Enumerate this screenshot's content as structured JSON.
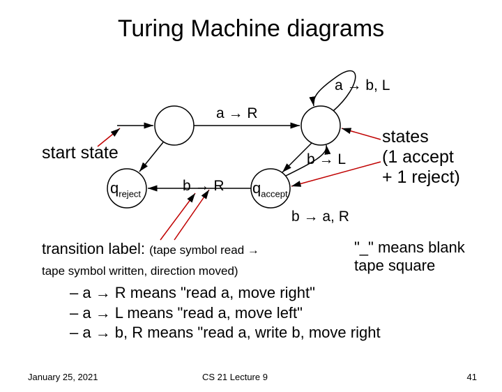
{
  "title": "Turing Machine diagrams",
  "labels": {
    "start_state": "start state",
    "a_to_R": "a → R",
    "b_to_R": "b → R",
    "a_to_bL": "a → b, L",
    "b_to_L": "b → L",
    "b_to_aR": "b → a, R",
    "q_reject_main": "q",
    "q_reject_sub": "reject",
    "q_accept_main": "q",
    "q_accept_sub": "accept"
  },
  "states_note": {
    "line1": "states",
    "line2": "(1 accept",
    "line3": "+ 1 reject)"
  },
  "transition_text": {
    "lead": "transition label: ",
    "paren1": "(tape symbol read → ",
    "paren2": "tape symbol written, direction moved)"
  },
  "blank_note": {
    "line1": "\"_\" means blank",
    "line2": "tape square"
  },
  "bullets": {
    "b1": "– a → R means \"read a, move right\"",
    "b2": "– a → L means \"read a, move left\"",
    "b3": "– a → b, R means \"read a, write b, move right"
  },
  "footer": {
    "date": "January 25, 2021",
    "mid": "CS 21 Lecture 9",
    "page": "41"
  },
  "chart_data": {
    "type": "diagram",
    "description": "Turing Machine state diagram",
    "states": [
      {
        "id": "q0",
        "label": "",
        "start": true
      },
      {
        "id": "q1",
        "label": ""
      },
      {
        "id": "qreject",
        "label": "qreject"
      },
      {
        "id": "qaccept",
        "label": "qaccept"
      }
    ],
    "transitions": [
      {
        "from": "start_arrow",
        "to": "q0",
        "label": ""
      },
      {
        "from": "q0",
        "to": "q1",
        "label": "a → R"
      },
      {
        "from": "q1",
        "to": "q1",
        "label": "a → b, L",
        "self_loop": true
      },
      {
        "from": "q1",
        "to": "qaccept",
        "label": "b → L"
      },
      {
        "from": "q0",
        "to": "qreject",
        "label": "b → R"
      },
      {
        "from": "qaccept",
        "to": "qreject",
        "label": "b → R"
      },
      {
        "from": "qaccept",
        "to": "q1",
        "label": "b → a, R"
      }
    ],
    "annotations": [
      "start state",
      "states (1 accept + 1 reject)",
      "transition label: (tape symbol read → tape symbol written, direction moved)",
      "\"_\" means blank tape square",
      "a → R means \"read a, move right\"",
      "a → L means \"read a, move left\"",
      "a → b, R means \"read a, write b, move right"
    ]
  }
}
